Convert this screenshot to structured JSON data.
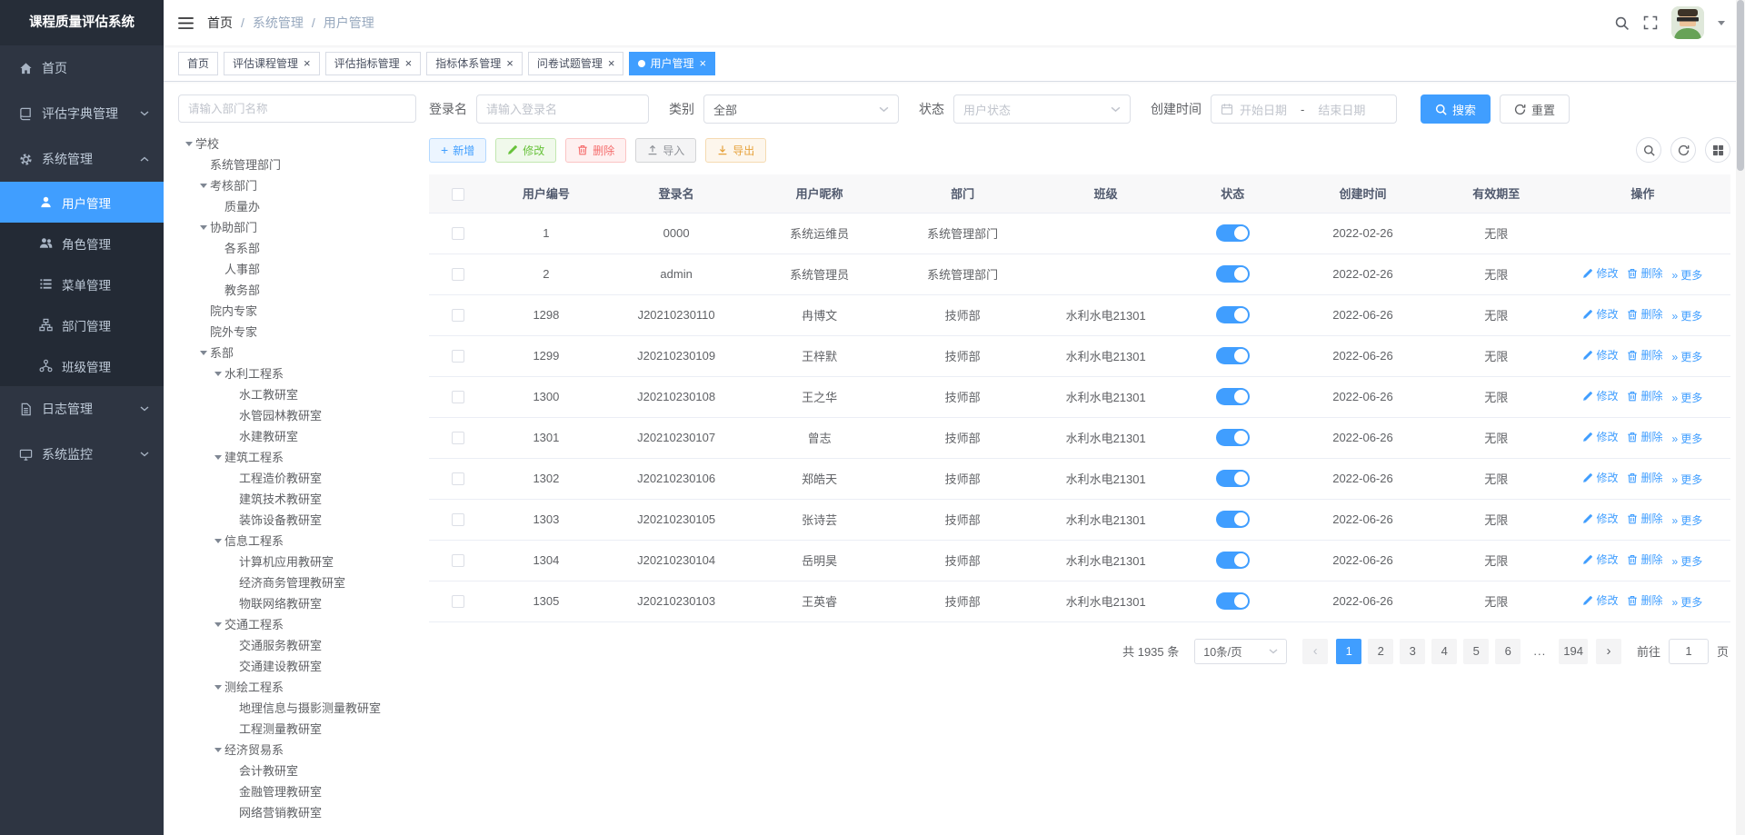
{
  "app": {
    "title": "课程质量评估系统"
  },
  "colors": {
    "primary": "#409EFF",
    "success": "#67C23A",
    "danger": "#F56C6C",
    "warning": "#E6A23C",
    "info": "#909399",
    "sidebar_bg": "#2e3542"
  },
  "header": {
    "breadcrumb": [
      "首页",
      "系统管理",
      "用户管理"
    ],
    "breadcrumb_separator": "/"
  },
  "sidebar": {
    "items": [
      {
        "name": "home",
        "icon": "home-icon",
        "label": "首页",
        "expandable": false,
        "expanded": false
      },
      {
        "name": "eval-dict-manage",
        "icon": "dict-icon",
        "label": "评估字典管理",
        "expandable": true,
        "expanded": false
      },
      {
        "name": "system-manage",
        "icon": "gear-icon",
        "label": "系统管理",
        "expandable": true,
        "expanded": true,
        "children": [
          {
            "name": "user-manage",
            "icon": "user-icon",
            "label": "用户管理",
            "active": true
          },
          {
            "name": "role-manage",
            "icon": "peoples-icon",
            "label": "角色管理",
            "active": false
          },
          {
            "name": "menu-manage",
            "icon": "list-icon",
            "label": "菜单管理",
            "active": false
          },
          {
            "name": "dept-manage",
            "icon": "tree-icon",
            "label": "部门管理",
            "active": false
          },
          {
            "name": "class-manage",
            "icon": "org-icon",
            "label": "班级管理",
            "active": false
          }
        ]
      },
      {
        "name": "log-manage",
        "icon": "log-icon",
        "label": "日志管理",
        "expandable": true,
        "expanded": false
      },
      {
        "name": "system-monitor",
        "icon": "monitor-icon",
        "label": "系统监控",
        "expandable": true,
        "expanded": false
      }
    ]
  },
  "tabs": [
    {
      "name": "home",
      "label": "首页",
      "closable": false,
      "active": false
    },
    {
      "name": "eval-course-manage",
      "label": "评估课程管理",
      "closable": true,
      "active": false
    },
    {
      "name": "eval-metric-manage",
      "label": "评估指标管理",
      "closable": true,
      "active": false
    },
    {
      "name": "metric-system-manage",
      "label": "指标体系管理",
      "closable": true,
      "active": false
    },
    {
      "name": "questionnaire-manage",
      "label": "问卷试题管理",
      "closable": true,
      "active": false
    },
    {
      "name": "user-manage",
      "label": "用户管理",
      "closable": true,
      "active": true
    }
  ],
  "dept_tree": {
    "search_placeholder": "请输入部门名称",
    "nodes": [
      {
        "label": "学校",
        "level": 0,
        "expandable": true
      },
      {
        "label": "系统管理部门",
        "level": 1,
        "expandable": false
      },
      {
        "label": "考核部门",
        "level": 1,
        "expandable": true
      },
      {
        "label": "质量办",
        "level": 2,
        "expandable": false
      },
      {
        "label": "协助部门",
        "level": 1,
        "expandable": true
      },
      {
        "label": "各系部",
        "level": 2,
        "expandable": false
      },
      {
        "label": "人事部",
        "level": 2,
        "expandable": false
      },
      {
        "label": "教务部",
        "level": 2,
        "expandable": false
      },
      {
        "label": "院内专家",
        "level": 1,
        "expandable": false
      },
      {
        "label": "院外专家",
        "level": 1,
        "expandable": false
      },
      {
        "label": "系部",
        "level": 1,
        "expandable": true
      },
      {
        "label": "水利工程系",
        "level": 2,
        "expandable": true
      },
      {
        "label": "水工教研室",
        "level": 3,
        "expandable": false
      },
      {
        "label": "水管园林教研室",
        "level": 3,
        "expandable": false
      },
      {
        "label": "水建教研室",
        "level": 3,
        "expandable": false
      },
      {
        "label": "建筑工程系",
        "level": 2,
        "expandable": true
      },
      {
        "label": "工程造价教研室",
        "level": 3,
        "expandable": false
      },
      {
        "label": "建筑技术教研室",
        "level": 3,
        "expandable": false
      },
      {
        "label": "装饰设备教研室",
        "level": 3,
        "expandable": false
      },
      {
        "label": "信息工程系",
        "level": 2,
        "expandable": true
      },
      {
        "label": "计算机应用教研室",
        "level": 3,
        "expandable": false
      },
      {
        "label": "经济商务管理教研室",
        "level": 3,
        "expandable": false
      },
      {
        "label": "物联网络教研室",
        "level": 3,
        "expandable": false
      },
      {
        "label": "交通工程系",
        "level": 2,
        "expandable": true
      },
      {
        "label": "交通服务教研室",
        "level": 3,
        "expandable": false
      },
      {
        "label": "交通建设教研室",
        "level": 3,
        "expandable": false
      },
      {
        "label": "测绘工程系",
        "level": 2,
        "expandable": true
      },
      {
        "label": "地理信息与摄影测量教研室",
        "level": 3,
        "expandable": false
      },
      {
        "label": "工程测量教研室",
        "level": 3,
        "expandable": false
      },
      {
        "label": "经济贸易系",
        "level": 2,
        "expandable": true
      },
      {
        "label": "会计教研室",
        "level": 3,
        "expandable": false
      },
      {
        "label": "金融管理教研室",
        "level": 3,
        "expandable": false
      },
      {
        "label": "网络营销教研室",
        "level": 3,
        "expandable": false
      }
    ]
  },
  "filters": {
    "login_name": {
      "label": "登录名",
      "placeholder": "请输入登录名",
      "value": ""
    },
    "category": {
      "label": "类别",
      "value": "全部"
    },
    "status": {
      "label": "状态",
      "placeholder": "用户状态",
      "value": ""
    },
    "create_time": {
      "label": "创建时间",
      "start_placeholder": "开始日期",
      "separator": "-",
      "end_placeholder": "结束日期"
    },
    "search_button": "搜索",
    "reset_button": "重置"
  },
  "toolbar": {
    "add": "新增",
    "edit": "修改",
    "delete": "删除",
    "import": "导入",
    "export": "导出"
  },
  "user_table": {
    "columns": [
      "用户编号",
      "登录名",
      "用户昵称",
      "部门",
      "班级",
      "状态",
      "创建时间",
      "有效期至",
      "操作"
    ],
    "row_actions": {
      "edit": "修改",
      "delete": "删除",
      "more": "更多"
    },
    "rows": [
      {
        "user_id": "1",
        "login_name": "0000",
        "nickname": "系统运维员",
        "dept": "系统管理部门",
        "class": "",
        "status_on": true,
        "created": "2022-02-26",
        "valid_until": "无限",
        "has_actions": false
      },
      {
        "user_id": "2",
        "login_name": "admin",
        "nickname": "系统管理员",
        "dept": "系统管理部门",
        "class": "",
        "status_on": true,
        "created": "2022-02-26",
        "valid_until": "无限",
        "has_actions": true
      },
      {
        "user_id": "1298",
        "login_name": "J20210230110",
        "nickname": "冉博文",
        "dept": "技师部",
        "class": "水利水电21301",
        "status_on": true,
        "created": "2022-06-26",
        "valid_until": "无限",
        "has_actions": true
      },
      {
        "user_id": "1299",
        "login_name": "J20210230109",
        "nickname": "王梓默",
        "dept": "技师部",
        "class": "水利水电21301",
        "status_on": true,
        "created": "2022-06-26",
        "valid_until": "无限",
        "has_actions": true
      },
      {
        "user_id": "1300",
        "login_name": "J20210230108",
        "nickname": "王之华",
        "dept": "技师部",
        "class": "水利水电21301",
        "status_on": true,
        "created": "2022-06-26",
        "valid_until": "无限",
        "has_actions": true
      },
      {
        "user_id": "1301",
        "login_name": "J20210230107",
        "nickname": "曾志",
        "dept": "技师部",
        "class": "水利水电21301",
        "status_on": true,
        "created": "2022-06-26",
        "valid_until": "无限",
        "has_actions": true
      },
      {
        "user_id": "1302",
        "login_name": "J20210230106",
        "nickname": "郑皓天",
        "dept": "技师部",
        "class": "水利水电21301",
        "status_on": true,
        "created": "2022-06-26",
        "valid_until": "无限",
        "has_actions": true
      },
      {
        "user_id": "1303",
        "login_name": "J20210230105",
        "nickname": "张诗芸",
        "dept": "技师部",
        "class": "水利水电21301",
        "status_on": true,
        "created": "2022-06-26",
        "valid_until": "无限",
        "has_actions": true
      },
      {
        "user_id": "1304",
        "login_name": "J20210230104",
        "nickname": "岳明昊",
        "dept": "技师部",
        "class": "水利水电21301",
        "status_on": true,
        "created": "2022-06-26",
        "valid_until": "无限",
        "has_actions": true
      },
      {
        "user_id": "1305",
        "login_name": "J20210230103",
        "nickname": "王英睿",
        "dept": "技师部",
        "class": "水利水电21301",
        "status_on": true,
        "created": "2022-06-26",
        "valid_until": "无限",
        "has_actions": true
      }
    ]
  },
  "pagination": {
    "total_text": "共 1935 条",
    "page_size_value": "10条/页",
    "pages": [
      "1",
      "2",
      "3",
      "4",
      "5",
      "6"
    ],
    "ellipsis": "...",
    "last_page": "194",
    "active_page": "1",
    "goto_label": "前往",
    "goto_value": "1",
    "goto_suffix": "页"
  }
}
